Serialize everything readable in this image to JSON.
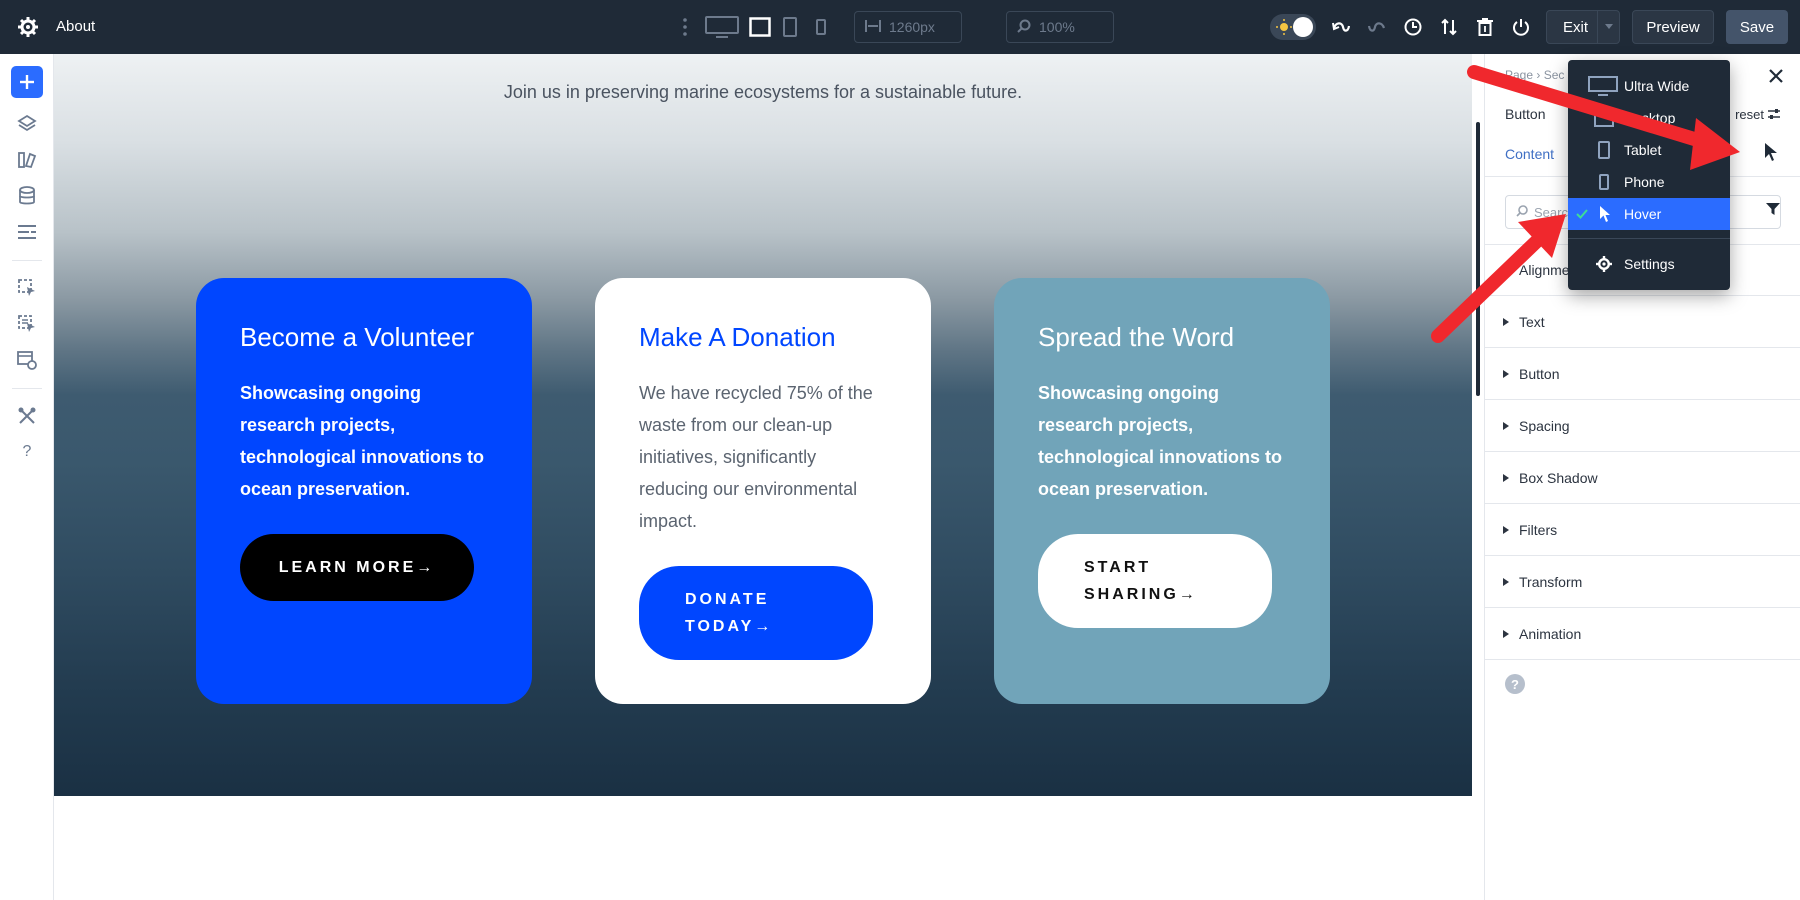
{
  "topbar": {
    "page_title": "About",
    "width_value": "1260px",
    "zoom_value": "100%",
    "exit_label": "Exit",
    "preview_label": "Preview",
    "save_label": "Save"
  },
  "canvas": {
    "tagline": "Join us in preserving marine ecosystems for a sustainable future.",
    "cards": [
      {
        "title": "Become a Volunteer",
        "body": "Showcasing ongoing research projects, technological innovations to ocean preservation.",
        "button": "LEARN MORE→"
      },
      {
        "title": "Make A Donation",
        "body": "We have recycled 75% of the waste from our clean-up initiatives, significantly reducing our environmental impact.",
        "button_line1": "DONATE",
        "button_line2": "TODAY→"
      },
      {
        "title": "Spread the Word",
        "body": "Showcasing ongoing research projects, technological innovations to ocean preservation.",
        "button_line1": "START",
        "button_line2": "SHARING→"
      }
    ]
  },
  "panel": {
    "breadcrumb_page": "Page",
    "breadcrumb_sep": "›",
    "breadcrumb_next": "Sec",
    "title": "Button",
    "preset_label": "reset",
    "tab_content": "Content",
    "search_placeholder": "Search",
    "sections": [
      "Alignment",
      "Text",
      "Button",
      "Spacing",
      "Box Shadow",
      "Filters",
      "Transform",
      "Animation"
    ],
    "help": "?"
  },
  "dropdown": {
    "items": [
      {
        "label": "Ultra Wide",
        "icon": "monitor-icon"
      },
      {
        "label": "Desktop",
        "icon": "desktop-icon"
      },
      {
        "label": "Tablet",
        "icon": "tablet-icon"
      },
      {
        "label": "Phone",
        "icon": "phone-icon"
      },
      {
        "label": "Hover",
        "icon": "cursor-icon"
      }
    ],
    "settings_label": "Settings"
  },
  "colors": {
    "topbar_bg": "#1f2a37",
    "accent_blue": "#0046ff",
    "ui_blue": "#2b6cff",
    "card3_bg": "#71a4b9",
    "arrow_red": "#f0282d"
  }
}
